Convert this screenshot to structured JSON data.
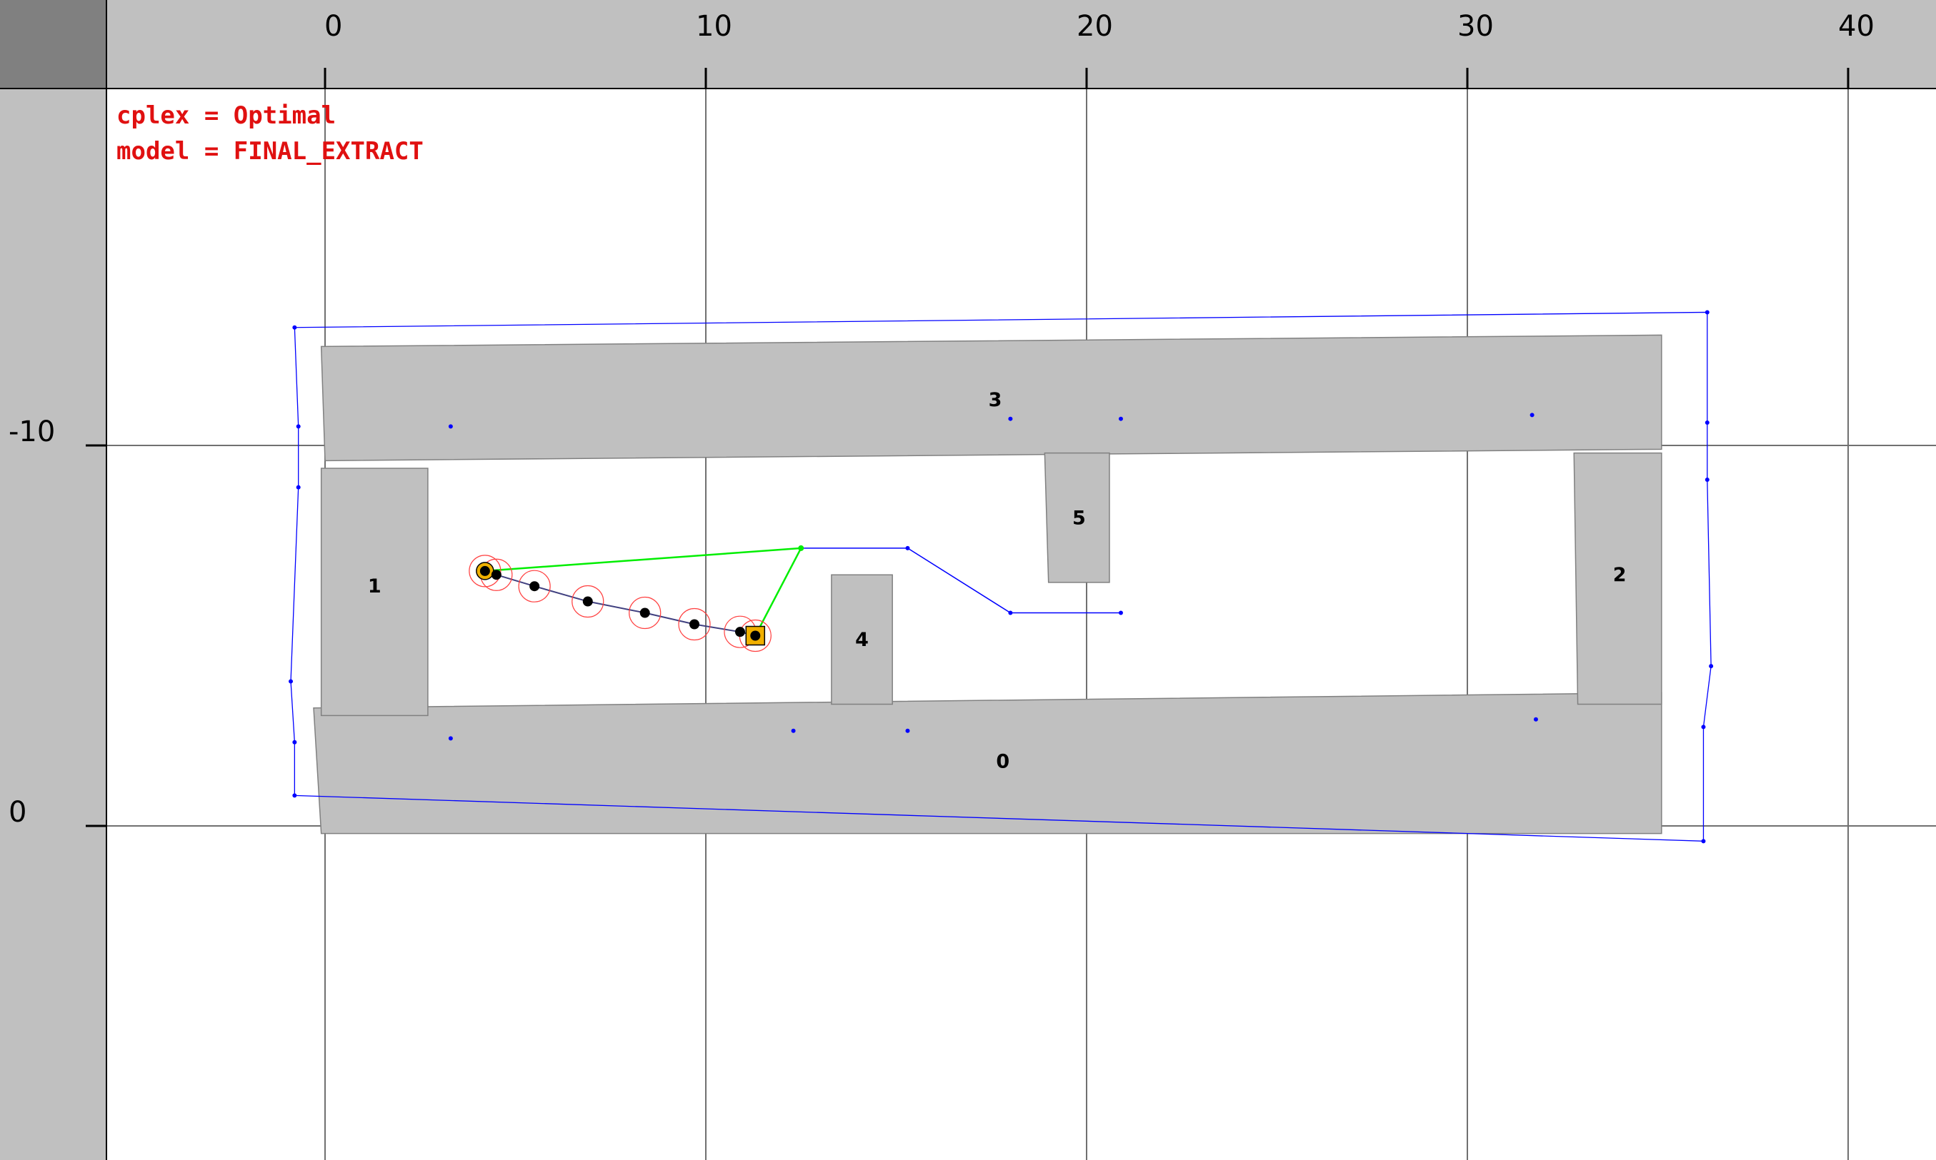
{
  "status": {
    "line1": "cplex = Optimal",
    "line2": "model = FINAL_EXTRACT"
  },
  "x_axis": {
    "ticks": [
      0,
      10,
      20,
      30,
      40
    ],
    "labels": [
      "0",
      "10",
      "20",
      "30",
      "40"
    ]
  },
  "y_axis": {
    "ticks": [
      -10,
      0
    ],
    "labels": [
      "-10",
      "0"
    ]
  },
  "colors": {
    "ruler": "#c0c0c0",
    "corner": "#808080",
    "obstacle_fill": "#c0c0c0",
    "obstacle_stroke": "#808080",
    "status_text": "#e01010",
    "hull": "#0000ff",
    "path": "#00ee00",
    "trajectory": "#404080",
    "circle": "#ff4040",
    "marker": "#f0b000"
  },
  "obstacles": [
    {
      "id": "0",
      "label": "0",
      "corners": [
        [
          -0.3,
          -3.1
        ],
        [
          35.1,
          -3.5
        ],
        [
          35.1,
          0.2
        ],
        [
          -0.1,
          0.2
        ]
      ],
      "label_at": [
        17.8,
        -1.7
      ]
    },
    {
      "id": "1",
      "label": "1",
      "corners": [
        [
          -0.1,
          -9.4
        ],
        [
          2.7,
          -9.4
        ],
        [
          2.7,
          -2.9
        ],
        [
          -0.1,
          -2.9
        ]
      ],
      "label_at": [
        1.3,
        -6.3
      ]
    },
    {
      "id": "2",
      "label": "2",
      "corners": [
        [
          32.8,
          -9.8
        ],
        [
          35.1,
          -9.8
        ],
        [
          35.1,
          -3.2
        ],
        [
          32.9,
          -3.2
        ]
      ],
      "label_at": [
        34.0,
        -6.6
      ]
    },
    {
      "id": "3",
      "label": "3",
      "corners": [
        [
          -0.1,
          -12.6
        ],
        [
          35.1,
          -12.9
        ],
        [
          35.1,
          -9.9
        ],
        [
          0.0,
          -9.6
        ]
      ],
      "label_at": [
        17.6,
        -11.2
      ]
    },
    {
      "id": "4",
      "label": "4",
      "corners": [
        [
          13.3,
          -6.6
        ],
        [
          14.9,
          -6.6
        ],
        [
          14.9,
          -3.2
        ],
        [
          13.3,
          -3.2
        ]
      ],
      "label_at": [
        14.1,
        -4.9
      ]
    },
    {
      "id": "5",
      "label": "5",
      "corners": [
        [
          18.9,
          -9.8
        ],
        [
          20.6,
          -9.8
        ],
        [
          20.6,
          -6.4
        ],
        [
          19.0,
          -6.4
        ]
      ],
      "label_at": [
        19.8,
        -8.1
      ]
    }
  ],
  "hull": [
    [
      -0.8,
      -13.1
    ],
    [
      36.3,
      -13.5
    ],
    [
      36.3,
      -10.6
    ],
    [
      36.3,
      -9.1
    ],
    [
      36.4,
      -4.2
    ],
    [
      36.2,
      -2.6
    ],
    [
      36.2,
      0.4
    ],
    [
      -0.8,
      -0.8
    ],
    [
      -0.8,
      -2.2
    ],
    [
      -0.9,
      -3.8
    ],
    [
      -0.7,
      -8.9
    ],
    [
      -0.7,
      -10.5
    ]
  ],
  "blue_dots": [
    [
      3.3,
      -10.5
    ],
    [
      18.0,
      -10.7
    ],
    [
      20.9,
      -10.7
    ],
    [
      31.7,
      -10.8
    ],
    [
      3.3,
      -2.3
    ],
    [
      12.3,
      -2.5
    ],
    [
      15.3,
      -2.5
    ],
    [
      31.8,
      -2.8
    ]
  ],
  "blue_polyline": [
    [
      12.5,
      -7.3
    ],
    [
      15.3,
      -7.3
    ],
    [
      18.0,
      -5.6
    ],
    [
      20.9,
      -5.6
    ]
  ],
  "green_path": [
    [
      4.2,
      -6.7
    ],
    [
      12.5,
      -7.3
    ],
    [
      11.3,
      -5.0
    ]
  ],
  "trajectory": [
    [
      4.2,
      -6.7
    ],
    [
      4.5,
      -6.6
    ],
    [
      5.5,
      -6.3
    ],
    [
      6.9,
      -5.9
    ],
    [
      8.4,
      -5.6
    ],
    [
      9.7,
      -5.3
    ],
    [
      10.9,
      -5.1
    ],
    [
      11.3,
      -5.0
    ]
  ],
  "start": [
    4.2,
    -6.7
  ],
  "goal": [
    11.3,
    -5.0
  ]
}
